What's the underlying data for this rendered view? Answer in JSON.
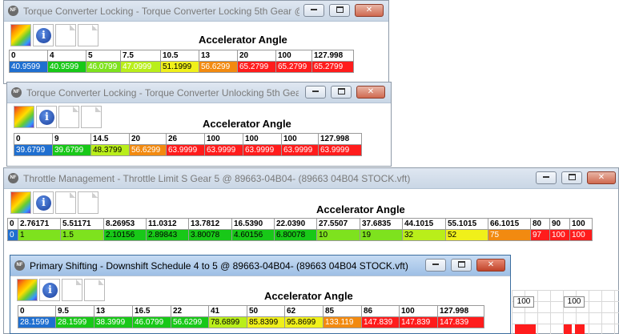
{
  "windows": [
    {
      "title": "Torque Converter Locking - Torque Converter Locking 5th Gear @",
      "heading": "Accelerator Angle",
      "headers": [
        "0",
        "4",
        "5",
        "7.5",
        "10.5",
        "13",
        "20",
        "100",
        "127.998"
      ],
      "values": [
        "40.9599",
        "40.9599",
        "46.0799",
        "47.0999",
        "51.1999",
        "56.6299",
        "65.2799",
        "65.2799",
        "65.2799"
      ],
      "value_colors": [
        "blue",
        "green",
        "lgreen",
        "lime",
        "yellow",
        "orange",
        "red",
        "red",
        "red"
      ]
    },
    {
      "title": "Torque Converter Locking - Torque Converter Unlocking 5th Gear",
      "heading": "Accelerator Angle",
      "headers": [
        "0",
        "9",
        "14.5",
        "20",
        "26",
        "100",
        "100",
        "100",
        "127.998"
      ],
      "values": [
        "39.6799",
        "39.6799",
        "48.3799",
        "56.6299",
        "63.9999",
        "63.9999",
        "63.9999",
        "63.9999",
        "63.9999"
      ],
      "value_colors": [
        "blue",
        "green",
        "lime",
        "orange",
        "red",
        "red",
        "red",
        "red",
        "red"
      ]
    },
    {
      "title": "Throttle Management - Throttle Limit S Gear 5 @ 89663-04B04- (89663 04B04 STOCK.vft)",
      "heading": "Accelerator Angle",
      "headers": [
        "0",
        "2.76171",
        "5.51171",
        "8.26953",
        "11.0312",
        "13.7812",
        "16.5390",
        "22.0390",
        "27.5507",
        "37.6835",
        "44.1015",
        "55.1015",
        "66.1015",
        "80",
        "90",
        "100"
      ],
      "values": [
        "0",
        "1",
        "1.5",
        "2.10156",
        "2.89843",
        "3.80078",
        "4.60156",
        "6.80078",
        "10",
        "19",
        "32",
        "52",
        "75",
        "97",
        "100",
        "100"
      ],
      "value_colors": [
        "blue",
        "lgreen",
        "lgreen",
        "green",
        "green",
        "green",
        "green",
        "green",
        "lgreen",
        "lgreen",
        "lime",
        "yellow",
        "orange",
        "red",
        "red",
        "red"
      ]
    },
    {
      "title": "Primary Shifting - Downshift Schedule 4 to 5 @ 89663-04B04- (89663 04B04 STOCK.vft)",
      "heading": "Accelerator Angle",
      "headers": [
        "0",
        "9.5",
        "13",
        "16.5",
        "22",
        "41",
        "50",
        "62",
        "85",
        "86",
        "100",
        "127.998"
      ],
      "values": [
        "28.1599",
        "28.1599",
        "38.3999",
        "46.0799",
        "56.6299",
        "78.6899",
        "85.8399",
        "95.8699",
        "133.119",
        "147.839",
        "147.839",
        "147.839"
      ],
      "value_colors": [
        "blue",
        "green",
        "green",
        "green",
        "green",
        "lime",
        "yellow",
        "yellow",
        "orange",
        "red",
        "red",
        "red"
      ]
    }
  ],
  "background_cells": [
    "100",
    "100"
  ],
  "app_icon_text": "NF",
  "info_icon_glyph": "i",
  "colors": {
    "selected_blue": "#1f6fd0",
    "green": "#18c818",
    "light_green": "#7ee21e",
    "lime": "#b9ee1a",
    "yellow": "#f0f01a",
    "orange": "#f28a10",
    "red": "#ff1c1c"
  }
}
